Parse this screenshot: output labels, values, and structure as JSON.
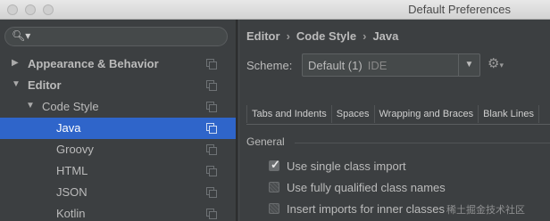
{
  "window": {
    "title": "Default Preferences"
  },
  "search": {
    "value": "",
    "placeholder": "",
    "icon": "search-icon"
  },
  "tree": {
    "items": [
      {
        "label": "Appearance & Behavior",
        "expanded": false,
        "selected": false
      },
      {
        "label": "Editor",
        "expanded": true,
        "selected": false
      },
      {
        "label": "Code Style",
        "expanded": true,
        "selected": false
      },
      {
        "label": "Java",
        "selected": true
      },
      {
        "label": "Groovy",
        "selected": false
      },
      {
        "label": "HTML",
        "selected": false
      },
      {
        "label": "JSON",
        "selected": false
      },
      {
        "label": "Kotlin",
        "selected": false
      }
    ]
  },
  "breadcrumb": {
    "items": [
      "Editor",
      "Code Style",
      "Java"
    ]
  },
  "scheme": {
    "label": "Scheme:",
    "value": "Default (1)",
    "scope": "IDE"
  },
  "tabs": [
    "Tabs and Indents",
    "Spaces",
    "Wrapping and Braces",
    "Blank Lines"
  ],
  "general": {
    "title": "General",
    "options": [
      {
        "label": "Use single class import",
        "checked": true
      },
      {
        "label": "Use fully qualified class names",
        "checked": false
      },
      {
        "label": "Insert imports for inner classes",
        "checked": false
      }
    ]
  },
  "watermark": "稀土掘金技术社区",
  "colors": {
    "background": "#3c3f41",
    "selection": "#2f65ca",
    "text": "#bbbbbb"
  }
}
